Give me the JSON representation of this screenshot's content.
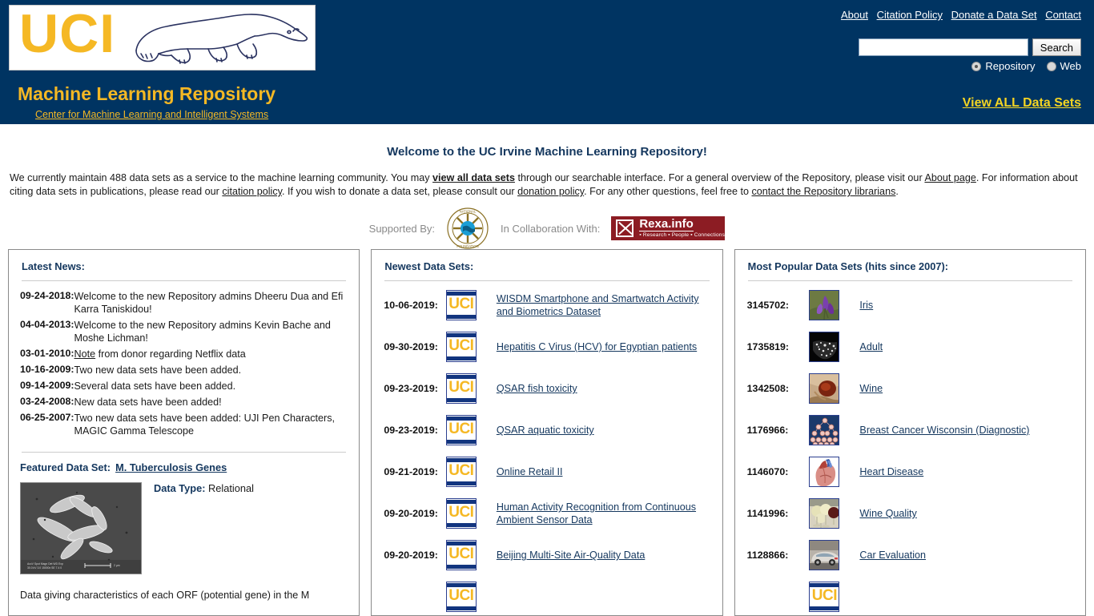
{
  "header": {
    "logo_text": "UCI",
    "site_title": "Machine Learning Repository",
    "site_subtitle": "Center for Machine Learning and Intelligent Systems",
    "nav": [
      {
        "label": "About"
      },
      {
        "label": "Citation Policy"
      },
      {
        "label": "Donate a Data Set"
      },
      {
        "label": "Contact"
      }
    ],
    "search": {
      "value": "",
      "placeholder": "",
      "button_label": "Search",
      "scopes": [
        {
          "label": "Repository",
          "checked": true
        },
        {
          "label": "Web",
          "checked": false
        }
      ]
    },
    "view_all_label": "View ALL Data Sets",
    "bg_color": "#003462",
    "accent_color": "#f5b824"
  },
  "welcome": {
    "title": "Welcome to the UC Irvine Machine Learning Repository!",
    "paragraph_part1": "We currently maintain 488 data sets as a service to the machine learning community. You may ",
    "link_view_all": "view all data sets",
    "paragraph_part2": " through our searchable interface. For a general overview of the Repository, please visit our ",
    "link_about": "About page",
    "paragraph_part3": ". For information about citing data sets in publications, please read our ",
    "link_citation": "citation policy",
    "paragraph_part4": ". If you wish to donate a data set, please consult our ",
    "link_donation": "donation policy",
    "paragraph_part5": ". For any other questions, feel free to ",
    "link_contact": "contact the Repository librarians",
    "paragraph_part6": ".",
    "dataset_count": "488",
    "supported_by_label": "Supported By:",
    "collaboration_label": "In Collaboration With:",
    "nsf_logo_name": "National Science Foundation",
    "rexa_name": "Rexa.info",
    "rexa_tagline": "▪ Research ▪ People ▪ Connections"
  },
  "news_panel": {
    "title": "Latest News:",
    "items": [
      {
        "date": "09-24-2018:",
        "text": "Welcome to the new Repository admins Dheeru Dua and Efi Karra Taniskidou!",
        "link": ""
      },
      {
        "date": "04-04-2013:",
        "text": "Welcome to the new Repository admins Kevin Bache and Moshe Lichman!",
        "link": ""
      },
      {
        "date": "03-01-2010:",
        "text": " from donor regarding Netflix data",
        "link": "Note"
      },
      {
        "date": "10-16-2009:",
        "text": "Two new data sets have been added.",
        "link": ""
      },
      {
        "date": "09-14-2009:",
        "text": "Several data sets have been added.",
        "link": ""
      },
      {
        "date": "03-24-2008:",
        "text": "New data sets have been added!",
        "link": ""
      },
      {
        "date": "06-25-2007:",
        "text": "Two new data sets have been added: UJI Pen Characters, MAGIC Gamma Telescope",
        "link": ""
      }
    ],
    "featured_label": "Featured Data Set:",
    "featured_name": "M. Tuberculosis Genes",
    "featured_datatype_label": "Data Type:",
    "featured_datatype_value": "Relational",
    "featured_description": "Data giving characteristics of each ORF (potential gene) in the M",
    "featured_image_name": "tuberculosis-micrograph"
  },
  "newest_panel": {
    "title": "Newest Data Sets:",
    "items": [
      {
        "date": "10-06-2019:",
        "name": "WISDM Smartphone and Smartwatch Activity and Biometrics Dataset",
        "thumb": "uci"
      },
      {
        "date": "09-30-2019:",
        "name": "Hepatitis C Virus (HCV) for Egyptian patients",
        "thumb": "uci"
      },
      {
        "date": "09-23-2019:",
        "name": "QSAR fish toxicity",
        "thumb": "uci"
      },
      {
        "date": "09-23-2019:",
        "name": "QSAR aquatic toxicity",
        "thumb": "uci"
      },
      {
        "date": "09-21-2019:",
        "name": "Online Retail II",
        "thumb": "uci"
      },
      {
        "date": "09-20-2019:",
        "name": "Human Activity Recognition from Continuous Ambient Sensor Data",
        "thumb": "uci"
      },
      {
        "date": "09-20-2019:",
        "name": "Beijing Multi-Site Air-Quality Data",
        "thumb": "uci"
      },
      {
        "date": "",
        "name": "",
        "thumb": "uci"
      }
    ]
  },
  "popular_panel": {
    "title": "Most Popular Data Sets (hits since 2007):",
    "items": [
      {
        "hits": "3145702:",
        "name": "Iris",
        "thumb": "iris-flower"
      },
      {
        "hits": "1735819:",
        "name": "Adult",
        "thumb": "usa-night-map"
      },
      {
        "hits": "1342508:",
        "name": "Wine",
        "thumb": "wine-glass"
      },
      {
        "hits": "1176966:",
        "name": "Breast Cancer Wisconsin (Diagnostic)",
        "thumb": "cell-diagram"
      },
      {
        "hits": "1146070:",
        "name": "Heart Disease",
        "thumb": "heart-anatomy"
      },
      {
        "hits": "1141996:",
        "name": "Wine Quality",
        "thumb": "wine-glasses"
      },
      {
        "hits": "1128866:",
        "name": "Car Evaluation",
        "thumb": "car-photo"
      },
      {
        "hits": "",
        "name": "",
        "thumb": "uci"
      }
    ]
  }
}
